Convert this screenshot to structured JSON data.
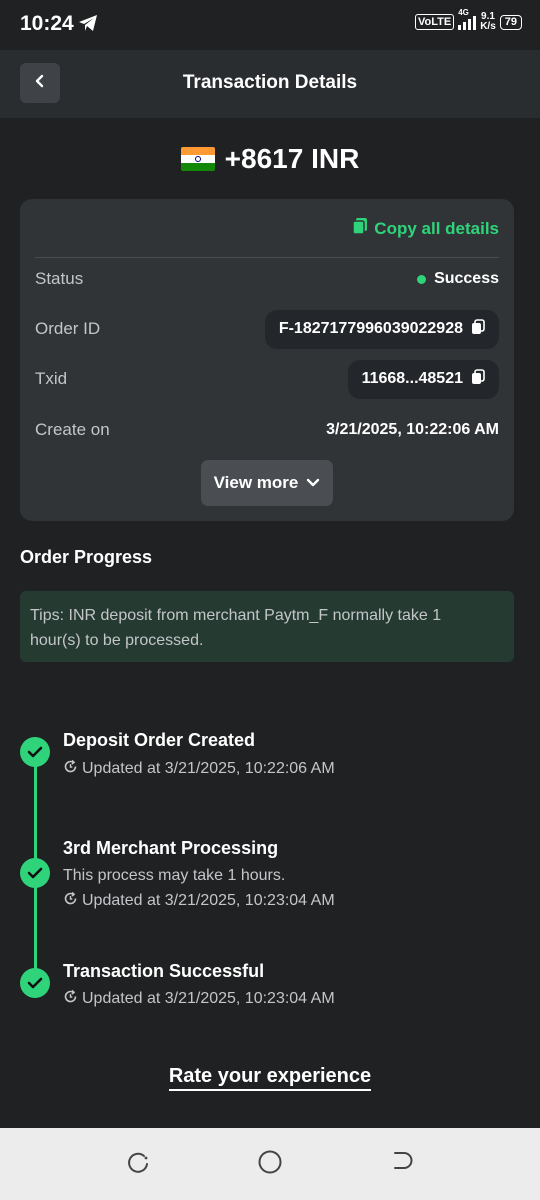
{
  "status_bar": {
    "time": "10:24",
    "volte": "VoLTE",
    "network": "4G",
    "speed_value": "9.1",
    "speed_unit": "K/s",
    "battery": "79"
  },
  "header": {
    "title": "Transaction Details"
  },
  "amount": {
    "value": "+8617 INR"
  },
  "details": {
    "copy_all_label": "Copy all details",
    "rows": [
      {
        "label": "Status",
        "value": "Success"
      },
      {
        "label": "Order ID",
        "value": "F-1827177996039022928"
      },
      {
        "label": "Txid",
        "value": "11668...48521"
      },
      {
        "label": "Create on",
        "value": "3/21/2025, 10:22:06 AM"
      }
    ],
    "view_more_label": "View more"
  },
  "progress": {
    "title": "Order Progress",
    "tips_line1": "Tips: INR deposit from merchant Paytm_F normally take 1",
    "tips_line2": "hour(s) to be processed.",
    "steps": [
      {
        "title": "Deposit Order Created",
        "updated": "Updated at 3/21/2025, 10:22:06 AM"
      },
      {
        "title": "3rd Merchant Processing",
        "note": "This process may take 1 hours.",
        "updated": "Updated at 3/21/2025, 10:23:04 AM"
      },
      {
        "title": "Transaction Successful",
        "updated": "Updated at 3/21/2025, 10:23:04 AM"
      }
    ]
  },
  "rate_label": "Rate your experience",
  "colors": {
    "accent_green": "#2fd47a",
    "background": "#1f2123",
    "card": "#303437"
  }
}
